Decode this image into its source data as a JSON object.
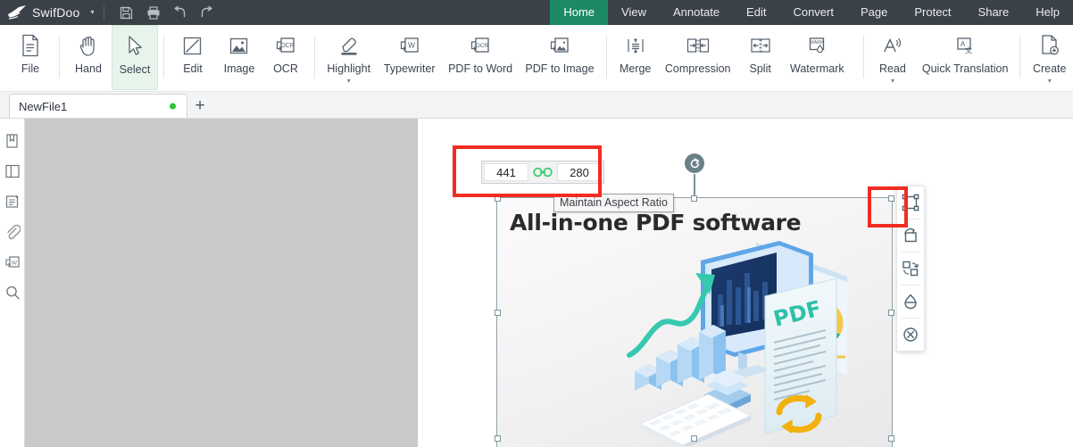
{
  "app": {
    "brand": "SwifDoo",
    "brand_caret": "▾"
  },
  "titlebar": {
    "quick_actions": [
      {
        "name": "save-icon",
        "label": "Save"
      },
      {
        "name": "print-icon",
        "label": "Print"
      },
      {
        "name": "undo-icon",
        "label": "Undo"
      },
      {
        "name": "redo-icon",
        "label": "Redo"
      }
    ],
    "menus": [
      {
        "label": "Home",
        "active": true
      },
      {
        "label": "View",
        "active": false
      },
      {
        "label": "Annotate",
        "active": false
      },
      {
        "label": "Edit",
        "active": false
      },
      {
        "label": "Convert",
        "active": false
      },
      {
        "label": "Page",
        "active": false
      },
      {
        "label": "Protect",
        "active": false
      },
      {
        "label": "Share",
        "active": false
      },
      {
        "label": "Help",
        "active": false
      }
    ]
  },
  "ribbon": {
    "items": [
      {
        "label": "File",
        "icon": "document-icon",
        "selected": false,
        "caret": false
      },
      {
        "label": "Hand",
        "icon": "hand-icon",
        "selected": false,
        "caret": false
      },
      {
        "label": "Select",
        "icon": "cursor-arrow-icon",
        "selected": true,
        "caret": false
      },
      {
        "label": "Edit",
        "icon": "edit-pencil-icon",
        "selected": false,
        "caret": false
      },
      {
        "label": "Image",
        "icon": "picture-icon",
        "selected": false,
        "caret": false
      },
      {
        "label": "OCR",
        "icon": "ocr-icon",
        "selected": false,
        "caret": false
      },
      {
        "label": "Highlight",
        "icon": "highlighter-icon",
        "selected": false,
        "caret": true
      },
      {
        "label": "Typewriter",
        "icon": "typewriter-w-icon",
        "selected": false,
        "caret": false
      },
      {
        "label": "PDF to Word",
        "icon": "pdf-to-word-icon",
        "selected": false,
        "caret": false
      },
      {
        "label": "PDF to Image",
        "icon": "pdf-to-image-icon",
        "selected": false,
        "caret": false
      },
      {
        "label": "Merge",
        "icon": "merge-icon",
        "selected": false,
        "caret": false
      },
      {
        "label": "Compression",
        "icon": "compression-icon",
        "selected": false,
        "caret": false
      },
      {
        "label": "Split",
        "icon": "split-icon",
        "selected": false,
        "caret": false
      },
      {
        "label": "Watermark",
        "icon": "watermark-icon",
        "selected": false,
        "caret": false
      },
      {
        "label": "Read",
        "icon": "read-aloud-icon",
        "selected": false,
        "caret": true
      },
      {
        "label": "Quick Translation",
        "icon": "translate-icon",
        "selected": false,
        "caret": false
      },
      {
        "label": "Create",
        "icon": "create-document-icon",
        "selected": false,
        "caret": true
      }
    ]
  },
  "tabstrip": {
    "document_tab": "NewFile1",
    "new_tab_label": "+",
    "unsaved_indicator": true
  },
  "rail": {
    "items": [
      {
        "name": "bookmark-icon",
        "label": "Bookmark"
      },
      {
        "name": "thumbnail-icon",
        "label": "Page Thumbnails"
      },
      {
        "name": "annotation-list-icon",
        "label": "Annotations"
      },
      {
        "name": "attachment-clip-icon",
        "label": "Attachments"
      },
      {
        "name": "convert-word-icon",
        "label": "Convert"
      },
      {
        "name": "search-icon",
        "label": "Search"
      }
    ]
  },
  "size_popup": {
    "width_value": "441",
    "height_value": "280",
    "link_icon": "chain-link-icon",
    "link_color": "#3ec96f"
  },
  "tooltip": {
    "text": "Maintain Aspect Ratio"
  },
  "page_content": {
    "headline": "All-in-one PDF software",
    "illustration": "isometric-pdf-workspace-illustration"
  },
  "image_toolbar": {
    "items": [
      {
        "name": "crop-resize-icon",
        "label": "Crop",
        "highlighted": true
      },
      {
        "name": "rotate-icon",
        "label": "Rotate",
        "highlighted": false
      },
      {
        "name": "replace-image-icon",
        "label": "Replace",
        "highlighted": false
      },
      {
        "name": "opacity-icon",
        "label": "Opacity",
        "highlighted": false
      },
      {
        "name": "delete-icon",
        "label": "Delete",
        "highlighted": false
      }
    ]
  },
  "annotations": {
    "highlight_color": "#f22c22",
    "boxes": [
      {
        "name": "size-popup-highlight"
      },
      {
        "name": "crop-tool-highlight"
      }
    ]
  },
  "selection": {
    "rotate_handle": "rotate-handle-icon",
    "handle_count": 8
  }
}
